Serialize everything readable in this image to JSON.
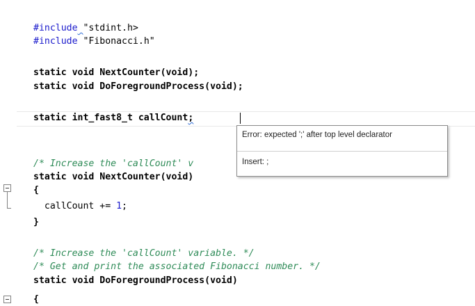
{
  "editor": {
    "lines": {
      "l1_kw": "#include",
      "l1_file": "\"stdint.h>",
      "l2_kw": "#include",
      "l2_file": "\"Fibonacci.h\"",
      "l3": "static void NextCounter(void);",
      "l4": "static void DoForegroundProcess(void);",
      "l5_a": "static int_fast8_t callCount",
      "l5_b": ";",
      "l6_cmt": "/* Increase the 'callCount' v",
      "l7": "static void NextCounter(void)",
      "l8": "{",
      "l9_a": "  callCount += ",
      "l9_num": "1",
      "l9_b": ";",
      "l10": "}",
      "l11_cmt": "/* Increase the 'callCount' variable. */",
      "l12_cmt": "/* Get and print the associated Fibonacci number. */",
      "l13": "static void DoForegroundProcess(void)",
      "l14": "{"
    }
  },
  "tooltip": {
    "error": "Error: expected ';' after top level declarator",
    "fix": "Insert: ;"
  },
  "icons": {
    "fold": "collapse-minus-icon"
  }
}
